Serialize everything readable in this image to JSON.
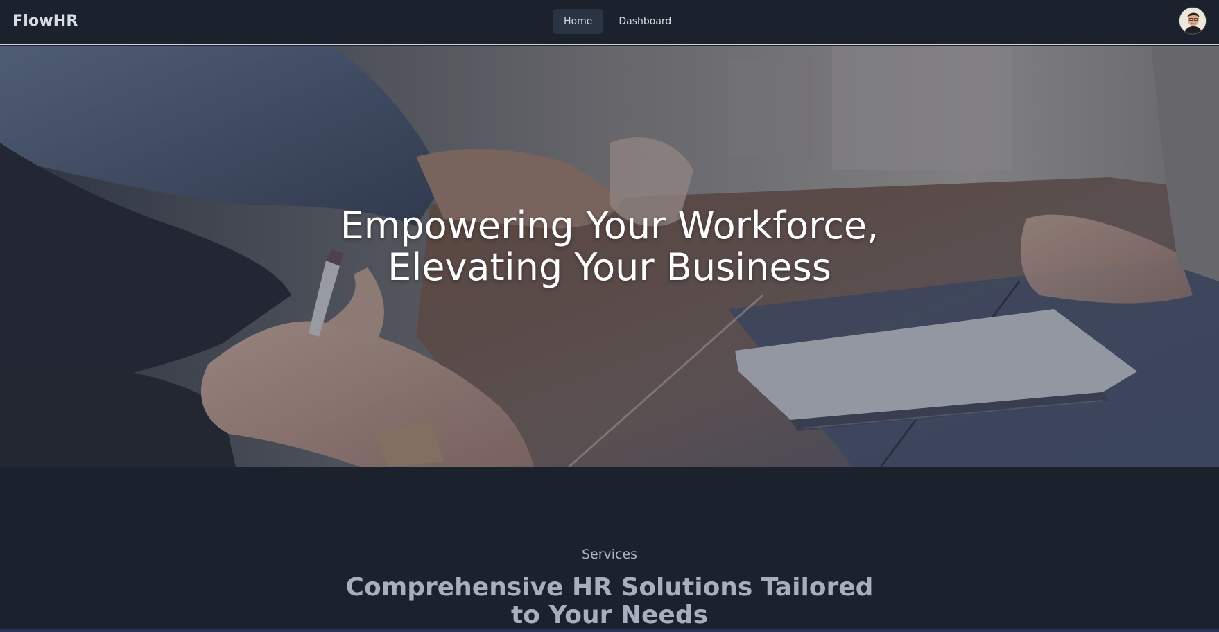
{
  "navbar": {
    "brand": "FlowHR",
    "links": [
      {
        "label": "Home",
        "active": true
      },
      {
        "label": "Dashboard",
        "active": false
      }
    ],
    "avatar_icon": "user-avatar"
  },
  "hero": {
    "title_line1": "Empowering Your Workforce,",
    "title_line2": "Elevating Your Business",
    "image": "photo of people writing at a wooden table"
  },
  "services": {
    "eyebrow": "Services",
    "heading_line1": "Comprehensive HR Solutions Tailored",
    "heading_line2": "to Your Needs"
  },
  "colors": {
    "background": "#1b222d",
    "nav_active": "#2b3442",
    "heading_muted": "#a7afbf"
  }
}
